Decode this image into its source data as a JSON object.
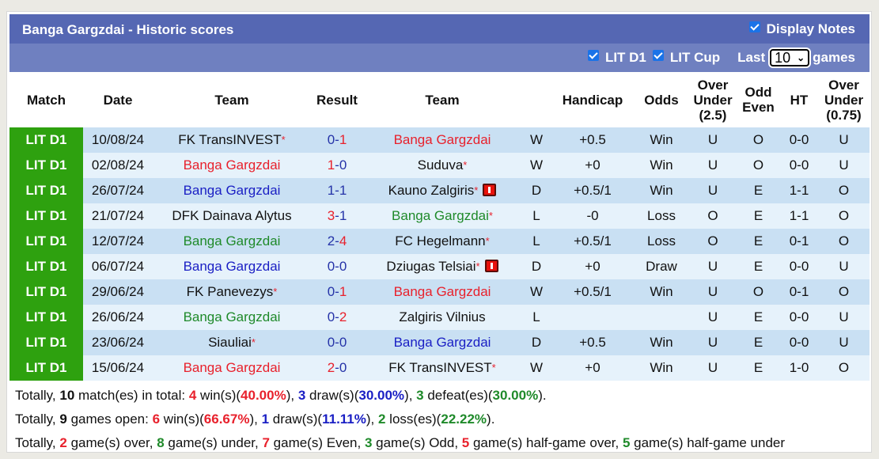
{
  "header": {
    "title": "Banga Gargzdai - Historic scores",
    "display_notes_label": "Display Notes",
    "display_notes_checked": true
  },
  "filters": {
    "lit_d1_label": "LIT D1",
    "lit_d1_checked": true,
    "lit_cup_label": "LIT Cup",
    "lit_cup_checked": true,
    "last_label": "Last",
    "games_count": "10",
    "games_label": "games"
  },
  "columns": [
    "Match",
    "Date",
    "Team",
    "Result",
    "Team",
    "",
    "Handicap",
    "Odds",
    "Over Under (2.5)",
    "Odd Even",
    "HT",
    "Over Under (0.75)"
  ],
  "column_lines": {
    "ou25": [
      "Over",
      "Under",
      "(2.5)"
    ],
    "oe": [
      "Odd",
      "Even"
    ],
    "ou075": [
      "Over",
      "Under",
      "(0.75)"
    ]
  },
  "rows": [
    {
      "league": "LIT D1",
      "date": "10/08/24",
      "home": "FK TransINVEST",
      "home_star": true,
      "home_color": "black",
      "home_card": false,
      "score_home": "0",
      "score_away": "1",
      "score_home_color": "navy",
      "score_away_color": "red",
      "away": "Banga Gargzdai",
      "away_star": false,
      "away_color": "red",
      "away_card": false,
      "wdl": "W",
      "handicap": "+0.5",
      "odds": "Win",
      "ou": "U",
      "oe": "O",
      "ht": "0-0",
      "ou075": "U"
    },
    {
      "league": "LIT D1",
      "date": "02/08/24",
      "home": "Banga Gargzdai",
      "home_star": false,
      "home_color": "red",
      "home_card": false,
      "score_home": "1",
      "score_away": "0",
      "score_home_color": "red",
      "score_away_color": "navy",
      "away": "Suduva",
      "away_star": true,
      "away_color": "black",
      "away_card": false,
      "wdl": "W",
      "handicap": "+0",
      "odds": "Win",
      "ou": "U",
      "oe": "O",
      "ht": "0-0",
      "ou075": "U"
    },
    {
      "league": "LIT D1",
      "date": "26/07/24",
      "home": "Banga Gargzdai",
      "home_star": false,
      "home_color": "blue",
      "home_card": false,
      "score_home": "1",
      "score_away": "1",
      "score_home_color": "navy",
      "score_away_color": "navy",
      "away": "Kauno Zalgiris",
      "away_star": true,
      "away_color": "black",
      "away_card": true,
      "wdl": "D",
      "handicap": "+0.5/1",
      "odds": "Win",
      "ou": "U",
      "oe": "E",
      "ht": "1-1",
      "ou075": "O"
    },
    {
      "league": "LIT D1",
      "date": "21/07/24",
      "home": "DFK Dainava Alytus",
      "home_star": false,
      "home_color": "black",
      "home_card": false,
      "score_home": "3",
      "score_away": "1",
      "score_home_color": "red",
      "score_away_color": "navy",
      "away": "Banga Gargzdai",
      "away_star": true,
      "away_color": "green",
      "away_card": false,
      "wdl": "L",
      "handicap": "-0",
      "odds": "Loss",
      "ou": "O",
      "oe": "E",
      "ht": "1-1",
      "ou075": "O"
    },
    {
      "league": "LIT D1",
      "date": "12/07/24",
      "home": "Banga Gargzdai",
      "home_star": false,
      "home_color": "green",
      "home_card": false,
      "score_home": "2",
      "score_away": "4",
      "score_home_color": "navy",
      "score_away_color": "red",
      "away": "FC Hegelmann",
      "away_star": true,
      "away_color": "black",
      "away_card": false,
      "wdl": "L",
      "handicap": "+0.5/1",
      "odds": "Loss",
      "ou": "O",
      "oe": "E",
      "ht": "0-1",
      "ou075": "O"
    },
    {
      "league": "LIT D1",
      "date": "06/07/24",
      "home": "Banga Gargzdai",
      "home_star": false,
      "home_color": "blue",
      "home_card": false,
      "score_home": "0",
      "score_away": "0",
      "score_home_color": "navy",
      "score_away_color": "navy",
      "away": "Dziugas Telsiai",
      "away_star": true,
      "away_color": "black",
      "away_card": true,
      "wdl": "D",
      "handicap": "+0",
      "odds": "Draw",
      "ou": "U",
      "oe": "E",
      "ht": "0-0",
      "ou075": "U"
    },
    {
      "league": "LIT D1",
      "date": "29/06/24",
      "home": "FK Panevezys",
      "home_star": true,
      "home_color": "black",
      "home_card": false,
      "score_home": "0",
      "score_away": "1",
      "score_home_color": "navy",
      "score_away_color": "red",
      "away": "Banga Gargzdai",
      "away_star": false,
      "away_color": "red",
      "away_card": false,
      "wdl": "W",
      "handicap": "+0.5/1",
      "odds": "Win",
      "ou": "U",
      "oe": "O",
      "ht": "0-1",
      "ou075": "O"
    },
    {
      "league": "LIT D1",
      "date": "26/06/24",
      "home": "Banga Gargzdai",
      "home_star": false,
      "home_color": "green",
      "home_card": false,
      "score_home": "0",
      "score_away": "2",
      "score_home_color": "navy",
      "score_away_color": "red",
      "away": "Zalgiris Vilnius",
      "away_star": false,
      "away_color": "black",
      "away_card": false,
      "wdl": "L",
      "handicap": "",
      "odds": "",
      "ou": "U",
      "oe": "E",
      "ht": "0-0",
      "ou075": "U"
    },
    {
      "league": "LIT D1",
      "date": "23/06/24",
      "home": "Siauliai",
      "home_star": true,
      "home_color": "black",
      "home_card": false,
      "score_home": "0",
      "score_away": "0",
      "score_home_color": "navy",
      "score_away_color": "navy",
      "away": "Banga Gargzdai",
      "away_star": false,
      "away_color": "blue",
      "away_card": false,
      "wdl": "D",
      "handicap": "+0.5",
      "odds": "Win",
      "ou": "U",
      "oe": "E",
      "ht": "0-0",
      "ou075": "U"
    },
    {
      "league": "LIT D1",
      "date": "15/06/24",
      "home": "Banga Gargzdai",
      "home_star": false,
      "home_color": "red",
      "home_card": false,
      "score_home": "2",
      "score_away": "0",
      "score_home_color": "red",
      "score_away_color": "navy",
      "away": "FK TransINVEST",
      "away_star": true,
      "away_color": "black",
      "away_card": false,
      "wdl": "W",
      "handicap": "+0",
      "odds": "Win",
      "ou": "U",
      "oe": "E",
      "ht": "1-0",
      "ou075": "O"
    }
  ],
  "summary": {
    "line1": [
      {
        "t": "Totally, "
      },
      {
        "t": "10",
        "c": "black",
        "b": true
      },
      {
        "t": " match(es) in total: "
      },
      {
        "t": "4",
        "c": "red",
        "b": true
      },
      {
        "t": " win(s)("
      },
      {
        "t": "40.00%",
        "c": "red",
        "b": true
      },
      {
        "t": "), "
      },
      {
        "t": "3",
        "c": "blue",
        "b": true
      },
      {
        "t": " draw(s)("
      },
      {
        "t": "30.00%",
        "c": "blue",
        "b": true
      },
      {
        "t": "), "
      },
      {
        "t": "3",
        "c": "green",
        "b": true
      },
      {
        "t": " defeat(es)("
      },
      {
        "t": "30.00%",
        "c": "green",
        "b": true
      },
      {
        "t": ")."
      }
    ],
    "line2": [
      {
        "t": "Totally, "
      },
      {
        "t": "9",
        "c": "black",
        "b": true
      },
      {
        "t": " games open: "
      },
      {
        "t": "6",
        "c": "red",
        "b": true
      },
      {
        "t": " win(s)("
      },
      {
        "t": "66.67%",
        "c": "red",
        "b": true
      },
      {
        "t": "), "
      },
      {
        "t": "1",
        "c": "blue",
        "b": true
      },
      {
        "t": " draw(s)("
      },
      {
        "t": "11.11%",
        "c": "blue",
        "b": true
      },
      {
        "t": "), "
      },
      {
        "t": "2",
        "c": "green",
        "b": true
      },
      {
        "t": " loss(es)("
      },
      {
        "t": "22.22%",
        "c": "green",
        "b": true
      },
      {
        "t": ")."
      }
    ],
    "line3": [
      {
        "t": "Totally, "
      },
      {
        "t": "2",
        "c": "red",
        "b": true
      },
      {
        "t": " game(s) over, "
      },
      {
        "t": "8",
        "c": "green",
        "b": true
      },
      {
        "t": " game(s) under, "
      },
      {
        "t": "7",
        "c": "red",
        "b": true
      },
      {
        "t": " game(s) Even, "
      },
      {
        "t": "3",
        "c": "green",
        "b": true
      },
      {
        "t": " game(s) Odd, "
      },
      {
        "t": "5",
        "c": "red",
        "b": true
      },
      {
        "t": " game(s) half-game over, "
      },
      {
        "t": "5",
        "c": "green",
        "b": true
      },
      {
        "t": " game(s) half-game under"
      }
    ]
  },
  "colors": {
    "title_bar": "#5567b3",
    "filter_bar": "#6f80c0",
    "league_cell": "#2ea10f",
    "row_a": "#c9e0f3",
    "row_b": "#e6f2fb",
    "red": "#e8212c",
    "blue": "#1a1fc4",
    "green": "#1f8a2a"
  }
}
